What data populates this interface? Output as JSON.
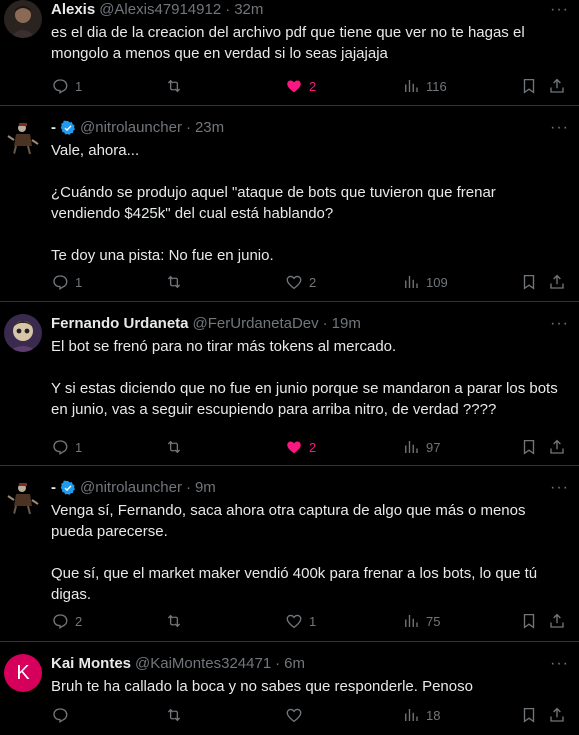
{
  "tweets": [
    {
      "name": "Alexis",
      "handle": "@Alexis47914912",
      "time": "32m",
      "text": "es el dia de la creacion del archivo pdf que tiene que ver no te hagas el mongolo a menos que en verdad si lo seas jajajaja",
      "replies": "1",
      "retweets": "",
      "likes": "2",
      "views": "116",
      "liked": true
    },
    {
      "name": "-",
      "handle": "@nitrolauncher",
      "time": "23m",
      "verified": true,
      "text": "Vale, ahora...\n\n¿Cuándo se produjo aquel \"ataque de bots que tuvieron que frenar vendiendo $425k\" del cual está hablando?\n\nTe doy una pista: No fue en junio.",
      "replies": "1",
      "retweets": "",
      "likes": "2",
      "views": "109",
      "liked": false
    },
    {
      "name": "Fernando Urdaneta",
      "handle": "@FerUrdanetaDev",
      "time": "19m",
      "text": "El bot se frenó para no tirar más tokens al mercado.\n\nY si estas diciendo que no fue en junio porque se mandaron a parar los bots en junio, vas a seguir escupiendo para arriba nitro, de verdad ????",
      "replies": "1",
      "retweets": "",
      "likes": "2",
      "views": "97",
      "liked": true
    },
    {
      "name": "-",
      "handle": "@nitrolauncher",
      "time": "9m",
      "verified": true,
      "text": "Venga sí, Fernando, saca ahora otra captura de algo que más o menos pueda parecerse.\n\nQue sí, que el market maker vendió 400k para frenar a los bots, lo que tú digas.",
      "replies": "2",
      "retweets": "",
      "likes": "1",
      "views": "75",
      "liked": false
    },
    {
      "name": "Kai Montes",
      "handle": "@KaiMontes324471",
      "time": "6m",
      "avatar_letter": "K",
      "text": "Bruh te ha callado la boca y no sabes que responderle. Penoso",
      "replies": "",
      "retweets": "",
      "likes": "",
      "views": "18",
      "liked": false
    }
  ],
  "colors": {
    "background": "#000000",
    "text": "#e7e9ea",
    "muted": "#71767b",
    "like_active": "#f91880",
    "verified": "#1d9bf0",
    "divider": "#2f3336",
    "kai_avatar": "#d6005c"
  },
  "icons": {
    "reply": "reply-icon",
    "retweet": "retweet-icon",
    "like": "heart-icon",
    "views": "views-icon",
    "bookmark": "bookmark-icon",
    "share": "share-icon",
    "more": "more-icon",
    "verified": "verified-badge-icon"
  }
}
